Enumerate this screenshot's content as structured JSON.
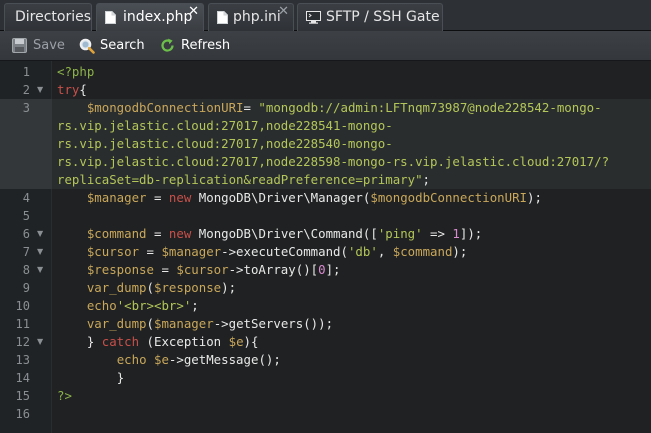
{
  "tabs": [
    {
      "label": "Directories",
      "active": false,
      "closable": false,
      "icon": "none"
    },
    {
      "label": "index.php",
      "active": true,
      "closable": true,
      "icon": "file-icon"
    },
    {
      "label": "php.ini",
      "active": false,
      "closable": true,
      "icon": "file-icon"
    },
    {
      "label": "SFTP / SSH Gate",
      "active": false,
      "closable": false,
      "icon": "monitor-icon"
    }
  ],
  "close_glyph": "✕",
  "toolbar": {
    "save_label": "Save",
    "search_label": "Search",
    "refresh_label": "Refresh"
  },
  "editor": {
    "active_line": 3,
    "line_numbers": [
      "1",
      "2",
      "3",
      "4",
      "5",
      "6",
      "7",
      "8",
      "9",
      "10",
      "11",
      "12",
      "13",
      "14",
      "15",
      "16"
    ],
    "fold_lines": [
      2,
      6,
      7,
      8,
      12
    ],
    "code": {
      "l1": {
        "open": "<?php"
      },
      "l2": {
        "kw": "try",
        "p": "{"
      },
      "l3": {
        "var": "$mongodbConnectionURI",
        "eq": "= ",
        "str": "\"mongodb://admin:LFTnqm73987@node228542-mongo-"
      },
      "l3b": {
        "str": "rs.vip.jelastic.cloud:27017,node228541-mongo-"
      },
      "l3c": {
        "str": "rs.vip.jelastic.cloud:27017,node228540-mongo-"
      },
      "l3d": {
        "str": "rs.vip.jelastic.cloud:27017,node228598-mongo-rs.vip.jelastic.cloud:27017/?"
      },
      "l3e": {
        "str": "replicaSet=db-replication&readPreference=primary\"",
        "end": ";"
      },
      "l4": {
        "var": "$manager",
        "eq": " = ",
        "kw": "new",
        "cls": " MongoDB\\Driver\\Manager(",
        "var2": "$mongodbConnectionURI",
        "end": ");"
      },
      "l6": {
        "var": "$command",
        "eq": " = ",
        "kw": "new",
        "cls": " MongoDB\\Driver\\Command([",
        "str": "'ping'",
        "op": " => ",
        "num": "1",
        "end": "]);"
      },
      "l7": {
        "var": "$cursor",
        "eq": " = ",
        "var2": "$manager",
        "op": "->executeCommand(",
        "str": "'db'",
        "sep": ", ",
        "var3": "$command",
        "end": ");"
      },
      "l8": {
        "var": "$response",
        "eq": " = ",
        "var2": "$cursor",
        "op": "->toArray()[",
        "num": "0",
        "end": "];"
      },
      "l9": {
        "fn": "var_dump",
        "p": "(",
        "var": "$response",
        "end": ");"
      },
      "l10": {
        "fn": "echo",
        "str": "'<br><br>'",
        "end": ";"
      },
      "l11": {
        "fn": "var_dump",
        "p": "(",
        "var": "$manager",
        "op": "->getServers());"
      },
      "l12": {
        "p": "} ",
        "kw": "catch",
        "p2": " (Exception ",
        "var": "$e",
        "end": "){"
      },
      "l13": {
        "fn": "echo ",
        "var": "$e",
        "op": "->getMessage();"
      },
      "l14": {
        "p": "}"
      },
      "l15": {
        "close": "?>"
      }
    }
  },
  "colors": {
    "keyword": "#c8504a",
    "variable": "#c9a75b",
    "string": "#b3c659",
    "number": "#d98bd0",
    "php_tag": "#8db34a"
  }
}
